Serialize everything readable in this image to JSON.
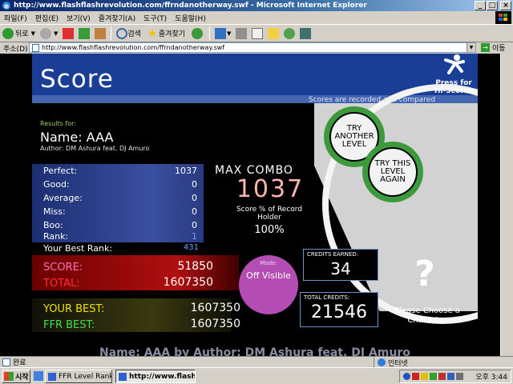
{
  "window": {
    "title": "http://www.flashflashrevolution.com/ffrndanotherway.swf - Microsoft Internet Explorer",
    "controls": [
      "_",
      "□",
      "×"
    ]
  },
  "menu": [
    "파일(F)",
    "편집(E)",
    "보기(V)",
    "즐겨찾기(A)",
    "도구(T)",
    "도움말(H)"
  ],
  "toolbar": {
    "back_label": "뒤로",
    "search_label": "검색",
    "favorites_label": "즐겨찾기"
  },
  "address": {
    "label": "주소(D)",
    "url": "http://www.flashflashrevolution.com/ffrndanotherway.swf",
    "go_label": "이동"
  },
  "game": {
    "title": "Score",
    "press_for": "Press for Hi-Scores",
    "header_note": "Scores are recorded and compared",
    "try_another": "TRY ANOTHER LEVEL",
    "try_level_again": "TRY THIS LEVEL AGAIN",
    "results_for": "Results for:",
    "name": "Name: AAA",
    "author": "Author: DM Ashura feat. DJ Amuro",
    "stats": [
      {
        "label": "Perfect:",
        "value": "1037"
      },
      {
        "label": "Good:",
        "value": "0"
      },
      {
        "label": "Average:",
        "value": "0"
      },
      {
        "label": "Miss:",
        "value": "0"
      },
      {
        "label": "Boo:",
        "value": "0"
      },
      {
        "label": "Rank:",
        "value": "1"
      }
    ],
    "best_rank_label": "Your Best Rank:",
    "best_rank": "431",
    "max_combo_label": "MAX COMBO",
    "max_combo": "1037",
    "pct_label": "Score % of Record Holder",
    "pct_value": "100%",
    "score_label": "SCORE:",
    "score": "51850",
    "total_label": "TOTAL:",
    "total": "1607350",
    "mode_label": "Mode:",
    "mode_value": "Off Visible",
    "credits_earned_label": "CREDITS EARNED:",
    "credits_earned": "34",
    "total_credits_label": "TOTAL CREDITS:",
    "total_credits": "21546",
    "question": "?",
    "choose": "Please Choose a Character",
    "your_best_label": "YOUR BEST:",
    "your_best": "1607350",
    "ffr_best_label": "FFR BEST:",
    "ffr_best": "1607350",
    "ticker": "Name: AAA by Author: DM Ashura feat. DJ Amuro"
  },
  "statusbar": {
    "left": "완료",
    "zone": "인터넷"
  },
  "taskbar": {
    "start": "시작",
    "tasks": [
      "FFR Level Ranks Fla...",
      "http://www.flashfl..."
    ],
    "clock": "오후 3:44"
  },
  "colors": {
    "header_blue": "#1a3e96",
    "try_button_green": "#3c9a3c",
    "combo_pink": "#ffb6b0",
    "your_best_yellow": "#f0e000",
    "ffr_best_green": "#44e044",
    "mode_purple": "#b34cb3"
  }
}
